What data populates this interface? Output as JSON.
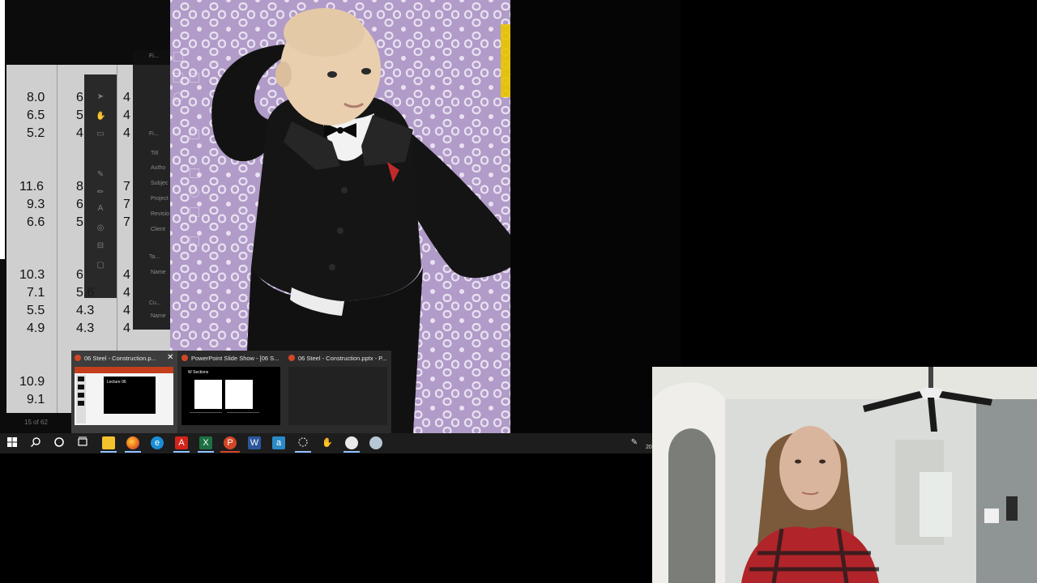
{
  "table": {
    "rows": [
      [
        "8.0",
        "6",
        "4"
      ],
      [
        "6.5",
        "5",
        "4"
      ],
      [
        "5.2",
        "4",
        "4"
      ],
      [
        "11.6",
        "8",
        "7"
      ],
      [
        "9.3",
        "6",
        "7"
      ],
      [
        "6.6",
        "5",
        "7"
      ],
      [
        "10.3",
        "6",
        "4"
      ],
      [
        "7.1",
        "5.6",
        "4"
      ],
      [
        "5.5",
        "4.3",
        "4"
      ],
      [
        "4.9",
        "4.3",
        "4"
      ],
      [
        "10.9",
        "",
        ""
      ],
      [
        "9.1",
        "",
        ""
      ]
    ],
    "page_counter": "15 of 62"
  },
  "props_panel": {
    "labels": [
      "Fi...",
      "Fi...",
      "Titl",
      "Autho",
      "Subjec",
      "Project",
      "Revisio",
      "Client",
      "Ta...",
      "Name",
      "Cu...",
      "Name"
    ]
  },
  "thumbnails": [
    {
      "title": "06 Steel - Construction.p...",
      "slide_heading": "Lecture 06"
    },
    {
      "title": "PowerPoint Slide Show - [06 S...",
      "slide_heading": "W Sections"
    },
    {
      "title": "06 Steel - Construction.pptx - P..."
    }
  ],
  "taskbar": {
    "icons": [
      "windows-start-icon",
      "search-icon",
      "cortana-icon",
      "task-view-icon",
      "file-explorer-icon",
      "firefox-icon",
      "edge-icon",
      "acrobat-icon",
      "excel-icon",
      "powerpoint-icon",
      "word-icon",
      "app-a-icon",
      "snipping-icon",
      "app-hands-icon",
      "app-map-icon",
      "app-globe-icon"
    ],
    "tray_clock_fragment": "20"
  },
  "colors": {
    "taskbar": "#1d1d1d",
    "ppt": "#d24726",
    "excel": "#1d6f42",
    "word": "#2b579a",
    "purple_pattern": "#b6a2cc"
  }
}
